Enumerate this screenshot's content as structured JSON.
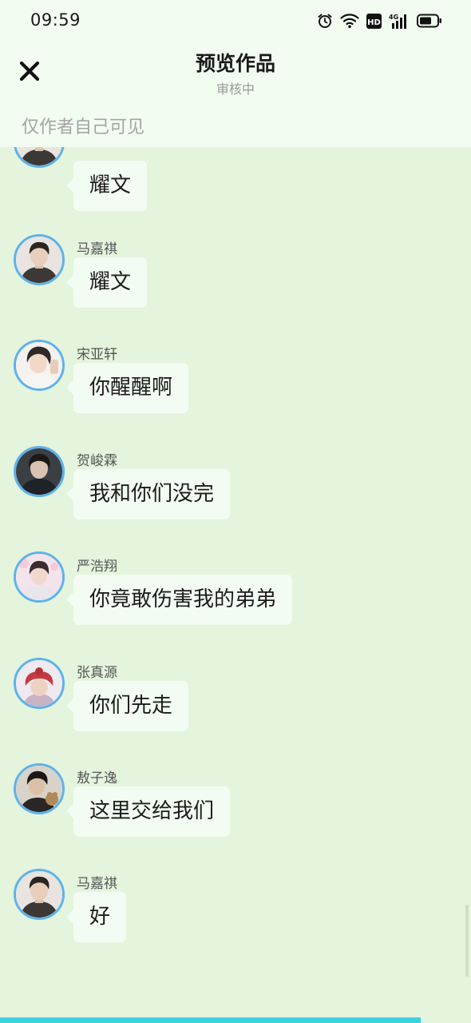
{
  "status_bar": {
    "time": "09:59",
    "icons": [
      "alarm-icon",
      "wifi-icon",
      "hd-icon",
      "signal-4g-icon",
      "battery-icon"
    ],
    "hd_label": "HD",
    "network_label": "4G"
  },
  "header": {
    "title": "预览作品",
    "subtitle": "审核中",
    "close_icon": "close-icon",
    "notice": "仅作者自己可见"
  },
  "messages": [
    {
      "sender": "",
      "text": "耀文"
    },
    {
      "sender": "马嘉祺",
      "text": "耀文"
    },
    {
      "sender": "宋亚轩",
      "text": "你醒醒啊"
    },
    {
      "sender": "贺峻霖",
      "text": "我和你们没完"
    },
    {
      "sender": "严浩翔",
      "text": "你竟敢伤害我的弟弟"
    },
    {
      "sender": "张真源",
      "text": "你们先走"
    },
    {
      "sender": "敖子逸",
      "text": "这里交给我们"
    },
    {
      "sender": "马嘉祺",
      "text": "好"
    }
  ],
  "colors": {
    "header_bg": "#f2fcf1",
    "chat_bg": "#e4f4dd",
    "bubble_bg": "#f3fcf2",
    "avatar_ring": "#5fb2ea",
    "bottom_accent": "#3fd0e2"
  }
}
